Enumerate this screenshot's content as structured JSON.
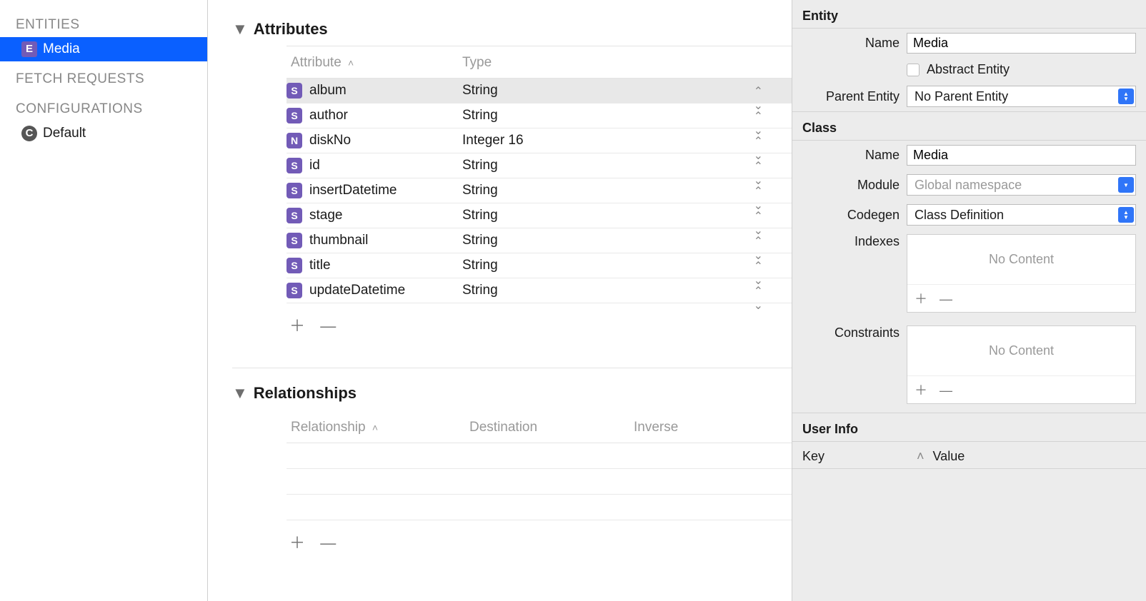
{
  "sidebar": {
    "entities_label": "ENTITIES",
    "entity_name": "Media",
    "fetch_label": "FETCH REQUESTS",
    "config_label": "CONFIGURATIONS",
    "config_item": "Default"
  },
  "sections": {
    "attributes_title": "Attributes",
    "relationships_title": "Relationships"
  },
  "attr_columns": {
    "c1": "Attribute",
    "c2": "Type"
  },
  "attributes": [
    {
      "icon": "S",
      "name": "album",
      "type": "String",
      "selected": true
    },
    {
      "icon": "S",
      "name": "author",
      "type": "String",
      "selected": false
    },
    {
      "icon": "N",
      "name": "diskNo",
      "type": "Integer 16",
      "selected": false
    },
    {
      "icon": "S",
      "name": "id",
      "type": "String",
      "selected": false
    },
    {
      "icon": "S",
      "name": "insertDatetime",
      "type": "String",
      "selected": false
    },
    {
      "icon": "S",
      "name": "stage",
      "type": "String",
      "selected": false
    },
    {
      "icon": "S",
      "name": "thumbnail",
      "type": "String",
      "selected": false
    },
    {
      "icon": "S",
      "name": "title",
      "type": "String",
      "selected": false
    },
    {
      "icon": "S",
      "name": "updateDatetime",
      "type": "String",
      "selected": false
    }
  ],
  "rel_columns": {
    "c1": "Relationship",
    "c2": "Destination",
    "c3": "Inverse"
  },
  "controls": {
    "plus": "＋",
    "minus": "—"
  },
  "inspector": {
    "entity_section": "Entity",
    "class_section": "Class",
    "userinfo_section": "User Info",
    "name_label": "Name",
    "abstract_label": "Abstract Entity",
    "parent_label": "Parent Entity",
    "module_label": "Module",
    "codegen_label": "Codegen",
    "indexes_label": "Indexes",
    "constraints_label": "Constraints",
    "entity_name_value": "Media",
    "parent_value": "No Parent Entity",
    "class_name_value": "Media",
    "module_placeholder": "Global namespace",
    "codegen_value": "Class Definition",
    "no_content": "No Content",
    "ui_key": "Key",
    "ui_value": "Value"
  }
}
